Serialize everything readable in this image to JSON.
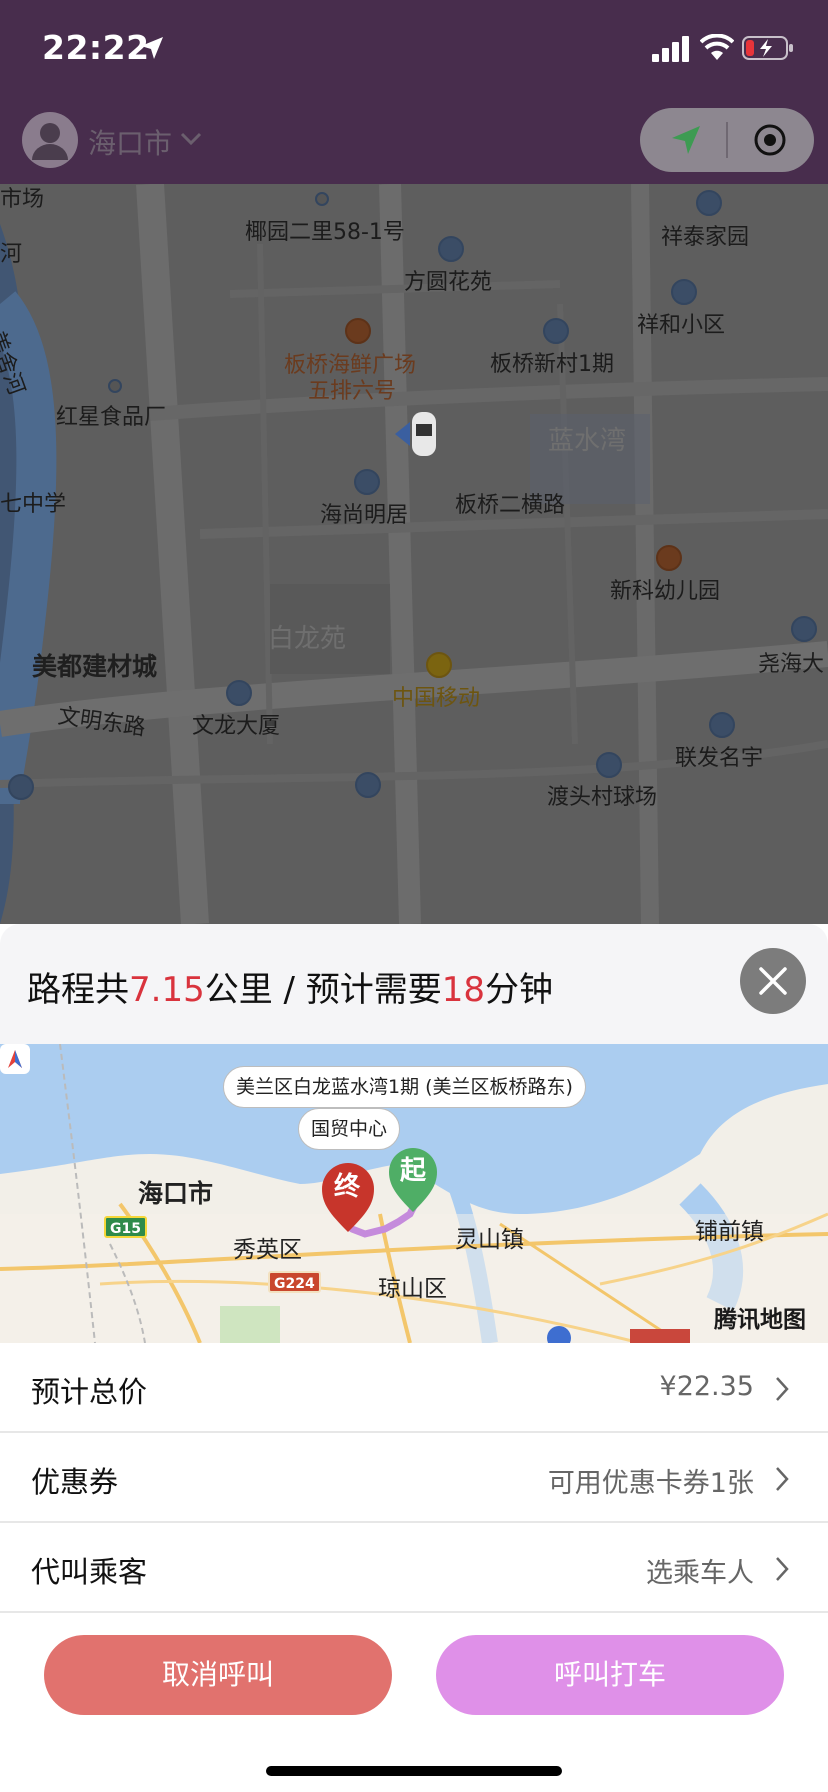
{
  "status_bar": {
    "time": "22:22"
  },
  "header": {
    "city": "海口市"
  },
  "background_map": {
    "labels": [
      {
        "text": "市场",
        "cls": "faint-s"
      },
      {
        "text": "椰园二里58-1号"
      },
      {
        "text": "祥泰家园"
      },
      {
        "text": "河"
      },
      {
        "text": "方圆花苑"
      },
      {
        "text": "美舍河"
      },
      {
        "text": "祥和小区"
      },
      {
        "text": "板桥海鲜广场"
      },
      {
        "text": "五排六号"
      },
      {
        "text": "板桥新村1期"
      },
      {
        "text": "红星食品厂"
      },
      {
        "text": "蓝水湾"
      },
      {
        "text": "七中学"
      },
      {
        "text": "海尚明居"
      },
      {
        "text": "板桥二横路"
      },
      {
        "text": "新科幼儿园"
      },
      {
        "text": "白龙苑"
      },
      {
        "text": "美都建材城"
      },
      {
        "text": "尧海大"
      },
      {
        "text": "中国移动"
      },
      {
        "text": "文明东路"
      },
      {
        "text": "文龙大厦"
      },
      {
        "text": "联发名宇"
      },
      {
        "text": "渡头村球场"
      }
    ]
  },
  "sheet": {
    "summary": {
      "prefix": "路程共",
      "distance": "7.15",
      "mid": "公里 / 预计需要",
      "minutes": "18",
      "suffix": "分钟"
    },
    "route_map": {
      "start_callout": "美兰区白龙蓝水湾1期 (美兰区板桥路东)",
      "end_callout": "国贸中心",
      "start_pin": "起",
      "end_pin": "终",
      "labels": {
        "haikou": "海口市",
        "xiuying": "秀英区",
        "qiongshan": "琼山区",
        "lingshan": "灵山镇",
        "puqian": "铺前镇"
      },
      "road_badges": {
        "g15": "G15",
        "g224": "G224"
      },
      "attribution": "腾讯地图"
    },
    "rows": [
      {
        "label": "预计总价",
        "value": "¥22.35"
      },
      {
        "label": "优惠券",
        "value": "可用优惠卡券1张"
      },
      {
        "label": "代叫乘客",
        "value": "选乘车人"
      }
    ],
    "buttons": {
      "cancel": "取消呼叫",
      "call": "呼叫打车"
    }
  },
  "colors": {
    "header_bg": "#482d4d",
    "highlight": "#d9333d",
    "cancel_button": "#e1726e",
    "call_button": "#df90e8",
    "route_line": "#c58bdc",
    "start_pin": "#4fae66",
    "end_pin": "#c7352b"
  }
}
